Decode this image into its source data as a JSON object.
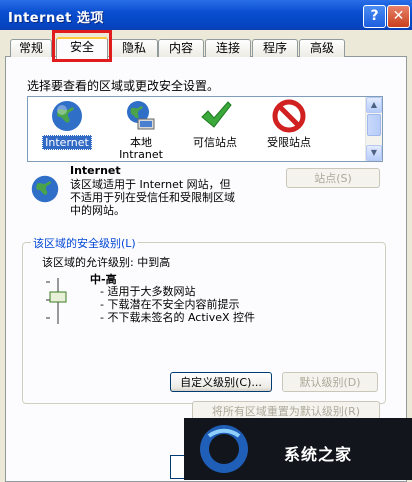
{
  "window": {
    "title": "Internet 选项",
    "help_label": "?",
    "close_label": "✕"
  },
  "tabs": [
    {
      "label": "常规"
    },
    {
      "label": "安全"
    },
    {
      "label": "隐私"
    },
    {
      "label": "内容"
    },
    {
      "label": "连接"
    },
    {
      "label": "程序"
    },
    {
      "label": "高级"
    }
  ],
  "security": {
    "prompt": "选择要查看的区域或更改安全设置。",
    "zones": [
      {
        "label": "Internet",
        "icon": "globe-icon",
        "selected": true
      },
      {
        "label": "本地\nIntranet",
        "icon": "intranet-icon"
      },
      {
        "label": "可信站点",
        "icon": "checkmark-icon"
      },
      {
        "label": "受限站点",
        "icon": "no-entry-icon"
      }
    ],
    "info": {
      "title": "Internet",
      "lines": [
        "该区域适用于 Internet 网站，但",
        "不适用于列在受信任和受限制区域",
        "中的网站。"
      ]
    },
    "sites_button": "站点(S)",
    "group_label": "该区域的安全级别(L)",
    "allowed_levels": "该区域的允许级别: 中到高",
    "level_name": "中-高",
    "level_bullets": [
      "- 适用于大多数网站",
      "- 下载潜在不安全内容前提示",
      "- 不下载未签名的 ActiveX 控件"
    ],
    "custom_button": "自定义级别(C)...",
    "default_button": "默认级别(D)",
    "reset_all_button": "将所有区域重置为默认级别(R)"
  },
  "watermark": {
    "text": "系统之家"
  },
  "colors": {
    "selection": "#316ac5",
    "highlight_box": "#e01c1c",
    "titlebar": "#0a4fd0"
  }
}
